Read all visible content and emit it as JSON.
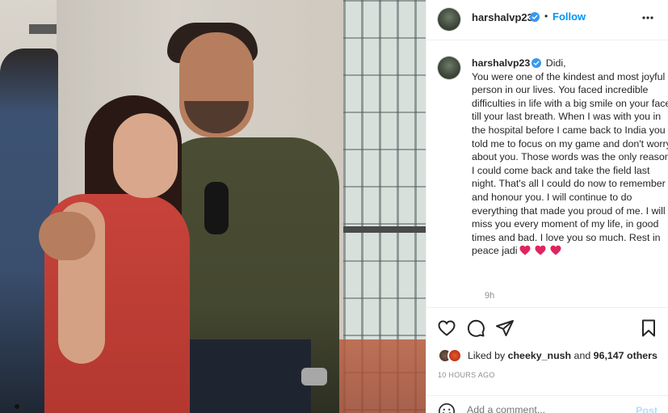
{
  "post": {
    "username": "harshalvp23",
    "follow_label": "Follow",
    "separator": "•",
    "caption": "Didi,\nYou were one of the kindest and most joyful person in our lives. You faced incredible difficulties in life with a big smile on your face till your last breath. When I was with you in the hospital before I came back to India you told me to focus on my game and don't worry about you. Those words was the only reason I could come back and take the field last night. That's all I could do now to remember and honour you. I will continue to do everything that made you proud of me. I will miss you every moment of my life, in good times and bad. I love you so much. Rest in peace jadi",
    "caption_time": "9h",
    "liked_by_prefix": "Liked by ",
    "liked_by_user": "cheeky_nush",
    "liked_by_mid": " and ",
    "liked_by_count": "96,147 others",
    "posted_ago": "10 HOURS AGO",
    "comment_placeholder": "Add a comment...",
    "post_label": "Post"
  },
  "icons": {
    "verified": "verified-badge-icon",
    "more": "more-options-icon",
    "like": "heart-icon",
    "comment": "comment-icon",
    "share": "share-icon",
    "save": "bookmark-icon",
    "emoji": "emoji-icon",
    "caption_hearts": "red-heart-emoji"
  },
  "colors": {
    "accent": "#0095f6",
    "verified": "#3897f0",
    "heart": "#e0245e"
  }
}
